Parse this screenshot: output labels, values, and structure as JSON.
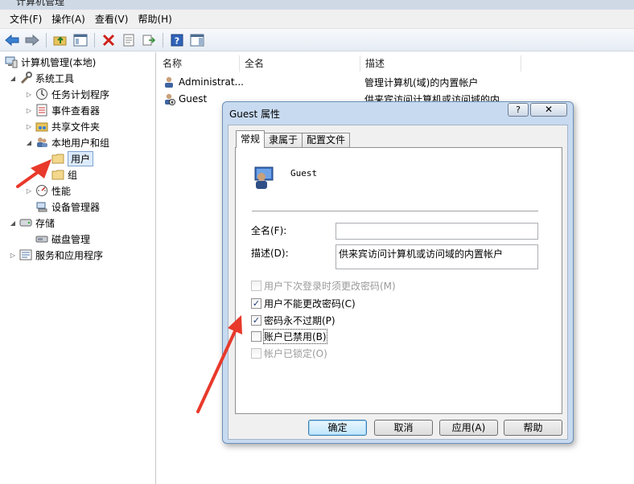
{
  "window": {
    "title": "计算机管理"
  },
  "menu": [
    "文件(F)",
    "操作(A)",
    "查看(V)",
    "帮助(H)"
  ],
  "tree": {
    "root": "计算机管理(本地)",
    "system_tools": "系统工具",
    "task_scheduler": "任务计划程序",
    "event_viewer": "事件查看器",
    "shared_folders": "共享文件夹",
    "local_users_groups": "本地用户和组",
    "users": "用户",
    "groups": "组",
    "performance": "性能",
    "device_manager": "设备管理器",
    "storage": "存储",
    "disk_management": "磁盘管理",
    "services_apps": "服务和应用程序"
  },
  "list": {
    "columns": [
      "名称",
      "全名",
      "描述"
    ],
    "rows": [
      {
        "name": "Administrat...",
        "description": "管理计算机(域)的内置帐户"
      },
      {
        "name": "Guest",
        "description": "供来宾访问计算机或访问域的内"
      }
    ]
  },
  "dialog": {
    "title": "Guest 属性",
    "help_label": "?",
    "close_label": "✕",
    "tabs": [
      "常规",
      "隶属于",
      "配置文件"
    ],
    "active_tab": "常规",
    "user_name": "Guest",
    "fullname_label": "全名(F):",
    "fullname_value": "",
    "description_label": "描述(D):",
    "description_value": "供来宾访问计算机或访问域的内置帐户",
    "checkboxes": {
      "must_change": {
        "label": "用户下次登录时须更改密码(M)",
        "checked": false,
        "enabled": false
      },
      "cannot_change": {
        "label": "用户不能更改密码(C)",
        "checked": true,
        "enabled": true
      },
      "never_expires": {
        "label": "密码永不过期(P)",
        "checked": true,
        "enabled": true
      },
      "disabled": {
        "label": "账户已禁用(B)",
        "checked": false,
        "enabled": true
      },
      "locked": {
        "label": "帐户已锁定(O)",
        "checked": false,
        "enabled": false
      }
    },
    "buttons": {
      "ok": "确定",
      "cancel": "取消",
      "apply": "应用(A)",
      "help": "帮助"
    }
  },
  "colors": {
    "annotation_arrow": "#e8392b",
    "selection": "#dcebfc"
  }
}
